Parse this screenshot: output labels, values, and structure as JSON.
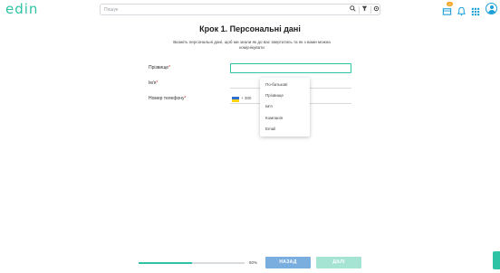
{
  "app": {
    "logo_text": "edin"
  },
  "header": {
    "search_placeholder": "Пошук",
    "search_icons": [
      "search-icon",
      "filter-icon",
      "settings-icon"
    ],
    "badge_count": "0",
    "icons": [
      "box-icon",
      "bell-icon",
      "apps-grid-icon",
      "user-avatar-icon"
    ]
  },
  "form": {
    "title": "Крок 1. Персональні дані",
    "description": "Вкажіть персональні дані, щоб ми знали як до вас звертатись та як з вами можна комунікувати",
    "fields": {
      "surname": {
        "label": "Прізвище",
        "required_mark": "*",
        "value": ""
      },
      "name": {
        "label": "Ім'я",
        "required_mark": "*",
        "value": ""
      },
      "phone": {
        "label": "Номер телефону",
        "required_mark": "*",
        "code": "+ 380"
      }
    },
    "dropdown": {
      "items": [
        "По-батькові",
        "Прізвище",
        "Ім'я",
        "Компанія",
        "Email"
      ]
    }
  },
  "footer": {
    "progress_percent": 50,
    "progress_text": "50%",
    "back_label": "НАЗАД",
    "next_label": "ДАЛІ"
  },
  "colors": {
    "brand": "#2ec3a4",
    "accent_blue": "#1a9fd7",
    "back_button": "#7aaede",
    "next_button": "#a5e3d3",
    "badge": "#f6a623"
  }
}
